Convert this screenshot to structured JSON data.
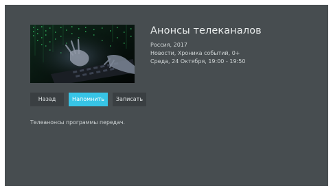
{
  "program": {
    "title": "Анонсы телеканалов",
    "country_year": "Россия, 2017",
    "genres": "Новости, Хроника событий, 0+",
    "schedule": "Среда, 24 Октября, 19:00 - 19:50",
    "description": "Телеанонсы программы передач."
  },
  "buttons": {
    "back": "Назад",
    "remind": "Напомнить",
    "record": "Записать"
  },
  "colors": {
    "background": "#474d50",
    "button": "#3a3f42",
    "accent": "#37c4e6"
  }
}
